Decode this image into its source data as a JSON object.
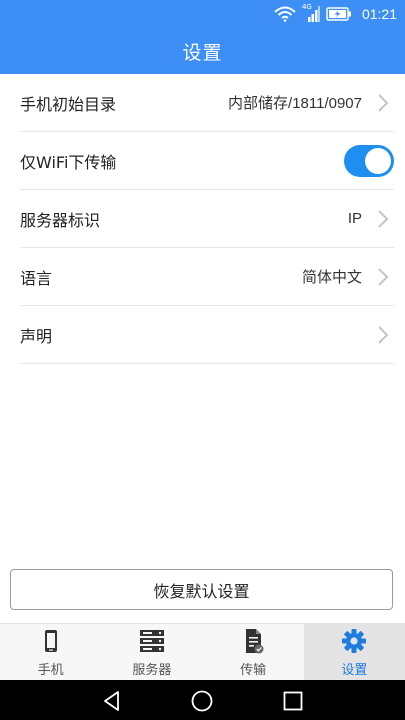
{
  "status_bar": {
    "network_label": "4G",
    "time": "01:21",
    "icons": [
      "wifi-icon",
      "signal-icon",
      "battery-charging-icon"
    ]
  },
  "header": {
    "title": "设置"
  },
  "settings": {
    "home_dir": {
      "label": "手机初始目录",
      "value": "内部储存/1811/0907"
    },
    "wifi_only": {
      "label": "仅WiFi下传输",
      "enabled": true
    },
    "server_id": {
      "label": "服务器标识",
      "value": "IP"
    },
    "language": {
      "label": "语言",
      "value": "简体中文"
    },
    "statement": {
      "label": "声明"
    }
  },
  "restore_button": {
    "label": "恢复默认设置"
  },
  "tabs": [
    {
      "label": "手机",
      "icon": "phone-icon",
      "active": false
    },
    {
      "label": "服务器",
      "icon": "server-icon",
      "active": false
    },
    {
      "label": "传输",
      "icon": "transfer-document-icon",
      "active": false
    },
    {
      "label": "设置",
      "icon": "gear-icon",
      "active": true
    }
  ],
  "colors": {
    "header_blue": "#3d8ff5",
    "toggle_on": "#1f8ef1",
    "active_tab_text": "#1e7ce0",
    "active_tab_bg": "#e4e4e4",
    "nav_bar": "#000000"
  },
  "system_nav": [
    "back-icon",
    "home-icon",
    "recents-icon"
  ]
}
